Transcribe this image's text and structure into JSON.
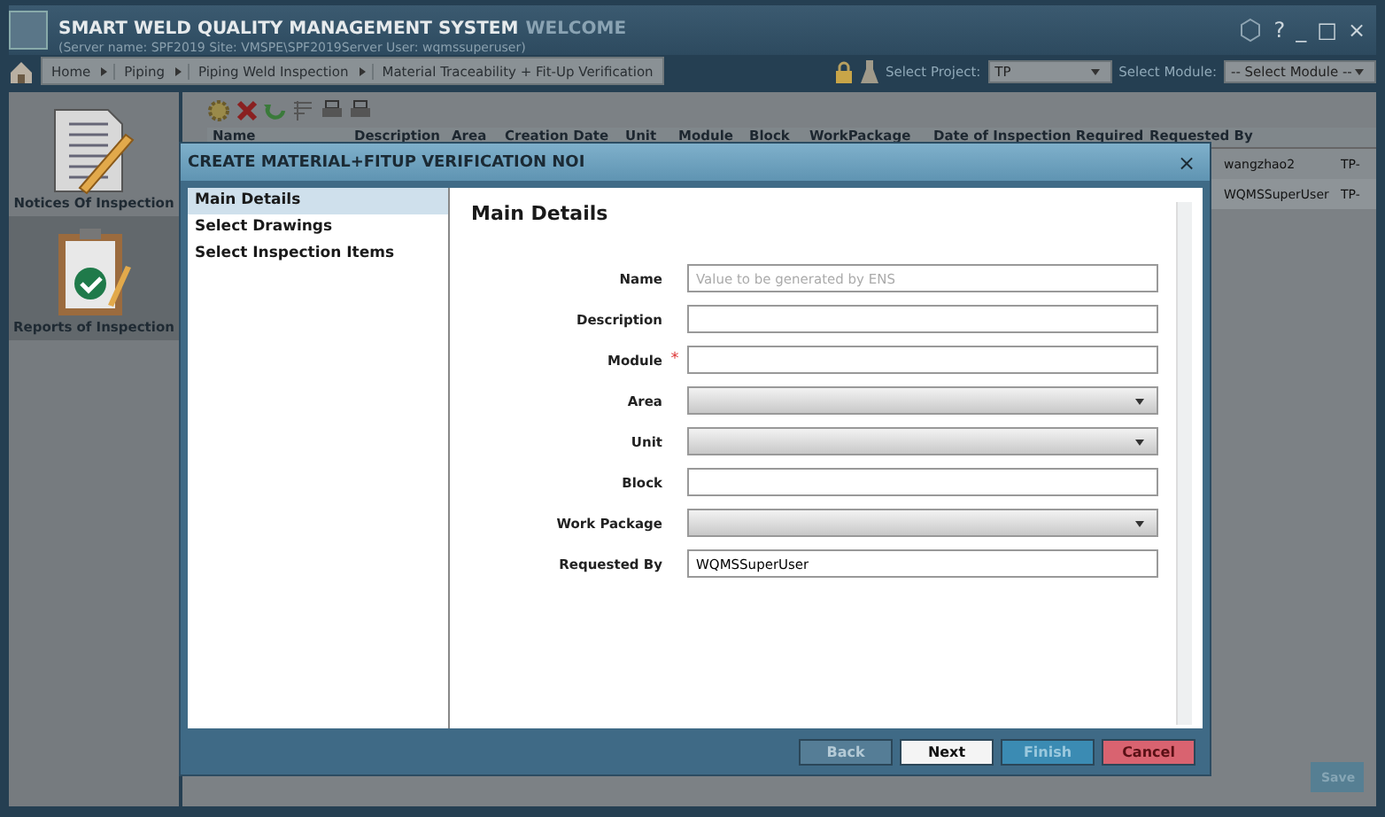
{
  "app": {
    "title": "SMART WELD QUALITY MANAGEMENT SYSTEM",
    "welcome": "WELCOME",
    "server_info": "(Server name: SPF2019 Site: VMSPE\\SPF2019Server User: wqmssuperuser)",
    "window_controls": [
      "?",
      "_",
      "□",
      "×"
    ]
  },
  "breadcrumb": [
    "Home",
    "Piping",
    "Piping Weld Inspection",
    "Material Traceability + Fit-Up Verification"
  ],
  "project": {
    "label": "Select Project:",
    "value": "TP"
  },
  "module": {
    "label": "Select Module:",
    "value": "-- Select Module --"
  },
  "sidebar": {
    "items": [
      {
        "label": "Notices Of Inspection",
        "kind": "notice",
        "selected": false
      },
      {
        "label": "Reports of Inspection",
        "kind": "report",
        "selected": true
      }
    ]
  },
  "grid": {
    "columns": [
      "Name",
      "Description",
      "Area",
      "Creation Date",
      "Unit",
      "Module",
      "Block",
      "WorkPackage",
      "Date of Inspection Required",
      "Requested By"
    ],
    "rows": [
      {
        "requested_by": "wangzhao2",
        "column_11": "TP-"
      },
      {
        "requested_by": "WQMSSuperUser",
        "column_11": "TP-"
      }
    ]
  },
  "save_button": {
    "label": "Save",
    "disabled": true
  },
  "dialog": {
    "title": "CREATE MATERIAL+FITUP VERIFICATION NOI",
    "close": "×",
    "steps": [
      {
        "label": "Main Details",
        "selected": true
      },
      {
        "label": "Select Drawings",
        "selected": false
      },
      {
        "label": "Select Inspection Items",
        "selected": false
      }
    ],
    "heading": "Main Details",
    "required_marker": "*",
    "fields": [
      {
        "label": "Name",
        "kind": "text",
        "required": false,
        "placeholder": "Value to be generated by ENS"
      },
      {
        "label": "Description",
        "kind": "text",
        "required": false
      },
      {
        "label": "Module",
        "kind": "text",
        "required": true
      },
      {
        "label": "Area",
        "kind": "select",
        "required": false
      },
      {
        "label": "Unit",
        "kind": "select",
        "required": false
      },
      {
        "label": "Block",
        "kind": "text",
        "required": false
      },
      {
        "label": "Work Package",
        "kind": "select",
        "required": false
      },
      {
        "label": "Requested By",
        "kind": "text",
        "required": false,
        "value": "WQMSSuperUser"
      }
    ],
    "buttons": [
      {
        "label": "Back",
        "kind": "neutral",
        "disabled": true
      },
      {
        "label": "Next",
        "kind": "neutral",
        "disabled": false
      },
      {
        "label": "Finish",
        "kind": "primary",
        "disabled": false
      },
      {
        "label": "Cancel",
        "kind": "danger",
        "disabled": false
      }
    ]
  }
}
